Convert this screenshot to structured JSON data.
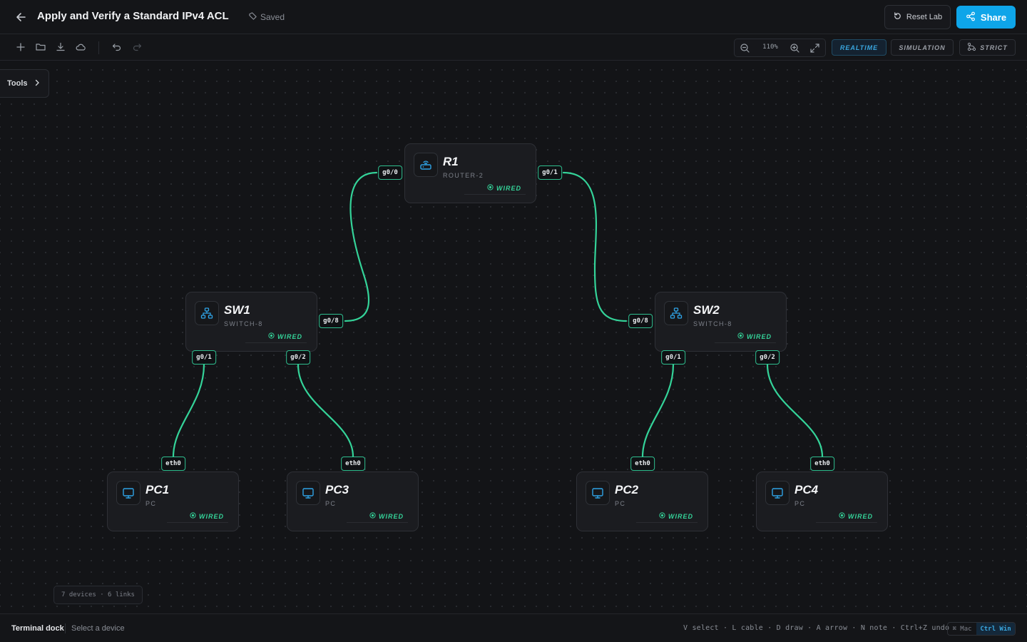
{
  "header": {
    "title": "Apply and Verify a Standard IPv4 ACL",
    "saved_label": "Saved",
    "reset_label": "Reset Lab",
    "share_label": "Share"
  },
  "toolbar": {
    "zoom": "110%",
    "modes": [
      "REALTIME",
      "SIMULATION",
      "STRICT"
    ],
    "active_mode": "REALTIME"
  },
  "canvas": {
    "tools_label": "Tools",
    "stats": "7 devices · 6 links"
  },
  "devices": {
    "r1": {
      "name": "R1",
      "type": "ROUTER-2",
      "status": "WIRED"
    },
    "sw1": {
      "name": "SW1",
      "type": "SWITCH-8",
      "status": "WIRED"
    },
    "sw2": {
      "name": "SW2",
      "type": "SWITCH-8",
      "status": "WIRED"
    },
    "pc1": {
      "name": "PC1",
      "type": "PC",
      "status": "WIRED"
    },
    "pc3": {
      "name": "PC3",
      "type": "PC",
      "status": "WIRED"
    },
    "pc2": {
      "name": "PC2",
      "type": "PC",
      "status": "WIRED"
    },
    "pc4": {
      "name": "PC4",
      "type": "PC",
      "status": "WIRED"
    }
  },
  "ports": {
    "r1_g00": "g0/0",
    "r1_g01": "g0/1",
    "sw1_g08": "g0/8",
    "sw1_g01": "g0/1",
    "sw1_g02": "g0/2",
    "sw2_g08": "g0/8",
    "sw2_g01": "g0/1",
    "sw2_g02": "g0/2",
    "pc1_eth0": "eth0",
    "pc3_eth0": "eth0",
    "pc2_eth0": "eth0",
    "pc4_eth0": "eth0"
  },
  "bottom": {
    "dock_label": "Terminal dock",
    "dock_hint": "Select a device",
    "shortcuts": "V select · L cable · D draw · A arrow · N note · Ctrl+Z undo",
    "os_mac": "⌘ Mac",
    "os_win": "Ctrl Win"
  },
  "colors": {
    "accent": "#0ea5e9",
    "link": "#34d399",
    "status_wired": "#34d399",
    "background": "#131417"
  },
  "icons": {
    "back": "arrow-left-icon",
    "saved": "cloud-tag-icon",
    "reset": "rotate-ccw-icon",
    "share": "share-icon",
    "new": "plus-icon",
    "open": "folder-open-icon",
    "download": "download-icon",
    "cloud": "cloud-icon",
    "undo": "undo-icon",
    "redo": "redo-icon",
    "zoom_out": "zoom-out-icon",
    "zoom_in": "zoom-in-icon",
    "fullscreen": "expand-icon",
    "router": "router-icon",
    "switch": "network-switch-icon",
    "pc": "monitor-icon"
  }
}
